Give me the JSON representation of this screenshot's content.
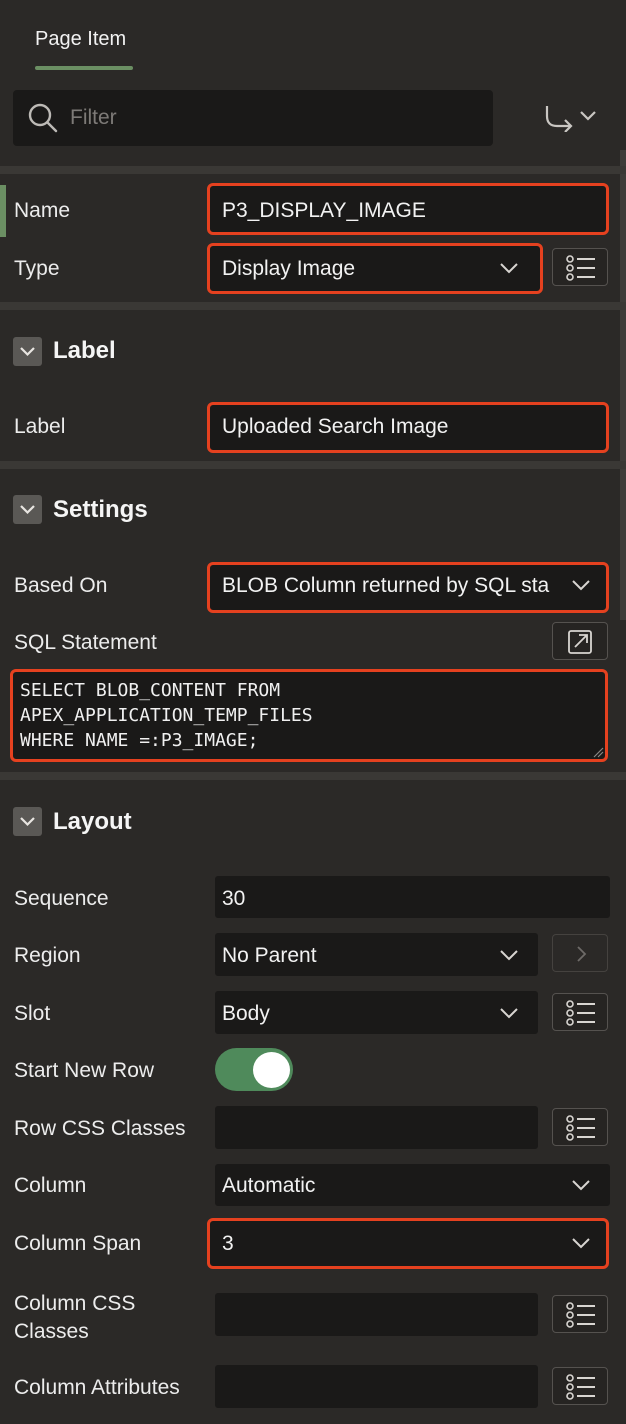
{
  "tab": {
    "label": "Page Item"
  },
  "filter": {
    "placeholder": "Filter"
  },
  "identification": {
    "name_label": "Name",
    "name_value": "P3_DISPLAY_IMAGE",
    "type_label": "Type",
    "type_value": "Display Image"
  },
  "label_section": {
    "title": "Label",
    "label_label": "Label",
    "label_value": "Uploaded Search Image"
  },
  "settings_section": {
    "title": "Settings",
    "based_on_label": "Based On",
    "based_on_value": "BLOB Column returned by SQL sta",
    "sql_label": "SQL Statement",
    "sql_value": "SELECT BLOB_CONTENT FROM\nAPEX_APPLICATION_TEMP_FILES\nWHERE NAME =:P3_IMAGE;"
  },
  "layout_section": {
    "title": "Layout",
    "sequence_label": "Sequence",
    "sequence_value": "30",
    "region_label": "Region",
    "region_value": "No Parent",
    "slot_label": "Slot",
    "slot_value": "Body",
    "start_new_row_label": "Start New Row",
    "row_css_label": "Row CSS Classes",
    "row_css_value": "",
    "column_label": "Column",
    "column_value": "Automatic",
    "column_span_label": "Column Span",
    "column_span_value": "3",
    "column_css_label_1": "Column CSS",
    "column_css_label_2": "Classes",
    "column_css_value": "",
    "column_attr_label": "Column Attributes",
    "column_attr_value": ""
  },
  "colors": {
    "highlight": "#e5411f",
    "toggle_on": "#4f8a5b",
    "accent": "#6b8f63"
  }
}
